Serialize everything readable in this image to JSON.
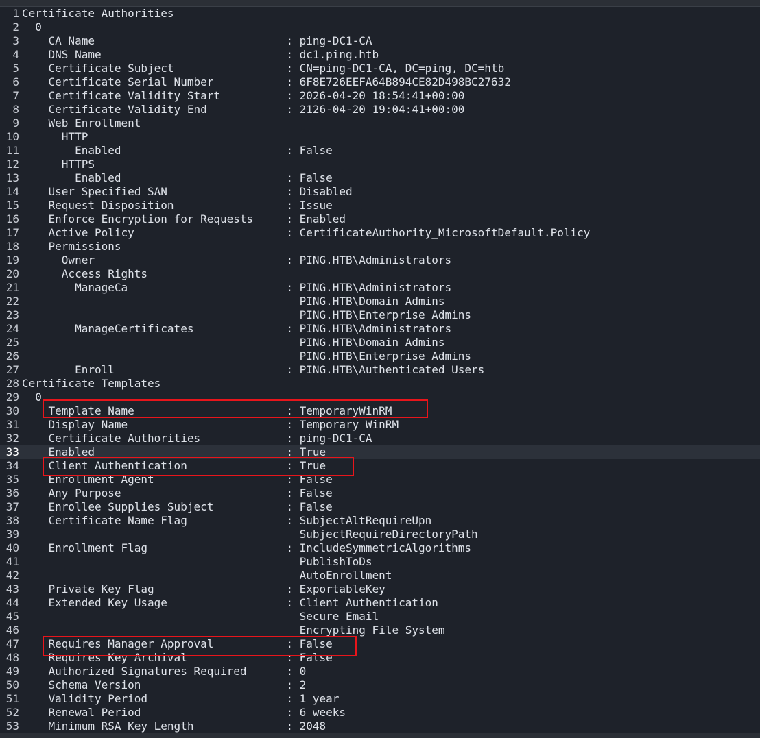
{
  "editor": {
    "cursor_line": 33,
    "lines": [
      {
        "n": "1",
        "text": "Certificate Authorities"
      },
      {
        "n": "2",
        "text": "  0"
      },
      {
        "n": "3",
        "text": "    CA Name                             : ping-DC1-CA"
      },
      {
        "n": "4",
        "text": "    DNS Name                            : dc1.ping.htb"
      },
      {
        "n": "5",
        "text": "    Certificate Subject                 : CN=ping-DC1-CA, DC=ping, DC=htb"
      },
      {
        "n": "6",
        "text": "    Certificate Serial Number           : 6F8E726EEFA64B894CE82D498BC27632"
      },
      {
        "n": "7",
        "text": "    Certificate Validity Start          : 2026-04-20 18:54:41+00:00"
      },
      {
        "n": "8",
        "text": "    Certificate Validity End            : 2126-04-20 19:04:41+00:00"
      },
      {
        "n": "9",
        "text": "    Web Enrollment"
      },
      {
        "n": "10",
        "text": "      HTTP"
      },
      {
        "n": "11",
        "text": "        Enabled                         : False"
      },
      {
        "n": "12",
        "text": "      HTTPS"
      },
      {
        "n": "13",
        "text": "        Enabled                         : False"
      },
      {
        "n": "14",
        "text": "    User Specified SAN                  : Disabled"
      },
      {
        "n": "15",
        "text": "    Request Disposition                 : Issue"
      },
      {
        "n": "16",
        "text": "    Enforce Encryption for Requests     : Enabled"
      },
      {
        "n": "17",
        "text": "    Active Policy                       : CertificateAuthority_MicrosoftDefault.Policy"
      },
      {
        "n": "18",
        "text": "    Permissions"
      },
      {
        "n": "19",
        "text": "      Owner                             : PING.HTB\\Administrators"
      },
      {
        "n": "20",
        "text": "      Access Rights"
      },
      {
        "n": "21",
        "text": "        ManageCa                        : PING.HTB\\Administrators"
      },
      {
        "n": "22",
        "text": "                                          PING.HTB\\Domain Admins"
      },
      {
        "n": "23",
        "text": "                                          PING.HTB\\Enterprise Admins"
      },
      {
        "n": "24",
        "text": "        ManageCertificates              : PING.HTB\\Administrators"
      },
      {
        "n": "25",
        "text": "                                          PING.HTB\\Domain Admins"
      },
      {
        "n": "26",
        "text": "                                          PING.HTB\\Enterprise Admins"
      },
      {
        "n": "27",
        "text": "        Enroll                          : PING.HTB\\Authenticated Users"
      },
      {
        "n": "28",
        "text": "Certificate Templates"
      },
      {
        "n": "29",
        "text": "  0"
      },
      {
        "n": "30",
        "text": "    Template Name                       : TemporaryWinRM"
      },
      {
        "n": "31",
        "text": "    Display Name                        : Temporary WinRM"
      },
      {
        "n": "32",
        "text": "    Certificate Authorities             : ping-DC1-CA"
      },
      {
        "n": "33",
        "text": "    Enabled                             : True"
      },
      {
        "n": "34",
        "text": "    Client Authentication               : True"
      },
      {
        "n": "35",
        "text": "    Enrollment Agent                    : False"
      },
      {
        "n": "36",
        "text": "    Any Purpose                         : False"
      },
      {
        "n": "37",
        "text": "    Enrollee Supplies Subject           : False"
      },
      {
        "n": "38",
        "text": "    Certificate Name Flag               : SubjectAltRequireUpn"
      },
      {
        "n": "39",
        "text": "                                          SubjectRequireDirectoryPath"
      },
      {
        "n": "40",
        "text": "    Enrollment Flag                     : IncludeSymmetricAlgorithms"
      },
      {
        "n": "41",
        "text": "                                          PublishToDs"
      },
      {
        "n": "42",
        "text": "                                          AutoEnrollment"
      },
      {
        "n": "43",
        "text": "    Private Key Flag                    : ExportableKey"
      },
      {
        "n": "44",
        "text": "    Extended Key Usage                  : Client Authentication"
      },
      {
        "n": "45",
        "text": "                                          Secure Email"
      },
      {
        "n": "46",
        "text": "                                          Encrypting File System"
      },
      {
        "n": "47",
        "text": "    Requires Manager Approval           : False"
      },
      {
        "n": "48",
        "text": "    Requires Key Archival               : False"
      },
      {
        "n": "49",
        "text": "    Authorized Signatures Required      : 0"
      },
      {
        "n": "50",
        "text": "    Schema Version                      : 2"
      },
      {
        "n": "51",
        "text": "    Validity Period                     : 1 year"
      },
      {
        "n": "52",
        "text": "    Renewal Period                      : 6 weeks"
      },
      {
        "n": "53",
        "text": "    Minimum RSA Key Length              : 2048"
      }
    ]
  },
  "highlights": {
    "color": "#e8151b"
  },
  "colors": {
    "background": "#1e222a",
    "text": "#dde1e8",
    "current_line": "#2c313a"
  }
}
